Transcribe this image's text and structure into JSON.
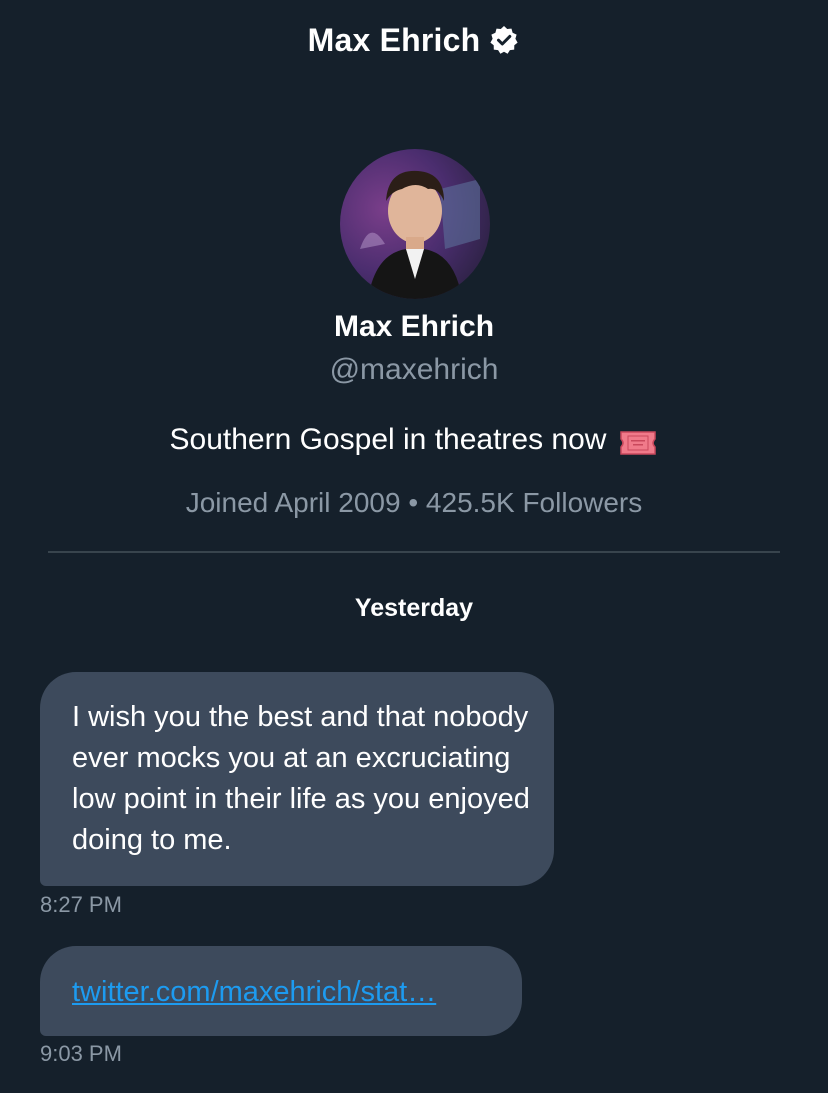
{
  "header": {
    "title": "Max Ehrich",
    "verified_icon": "verified-badge-icon"
  },
  "profile": {
    "name": "Max Ehrich",
    "handle": "@maxehrich",
    "bio": "Southern Gospel in theatres now",
    "bio_emoji": "ticket-icon",
    "joined": "Joined April 2009",
    "separator": "•",
    "followers": "425.5K Followers"
  },
  "conversation": {
    "day_label": "Yesterday",
    "messages": [
      {
        "text": "I wish you the best and that nobody ever mocks you at an excruciating low point in their life as you enjoyed doing to me.",
        "time": "8:27 PM"
      },
      {
        "link": "twitter.com/maxehrich/stat…",
        "time": "9:03 PM"
      }
    ]
  },
  "colors": {
    "background": "#15202b",
    "bubble": "#3d4a5c",
    "secondary_text": "#8b98a5",
    "link": "#1d9bf0"
  }
}
